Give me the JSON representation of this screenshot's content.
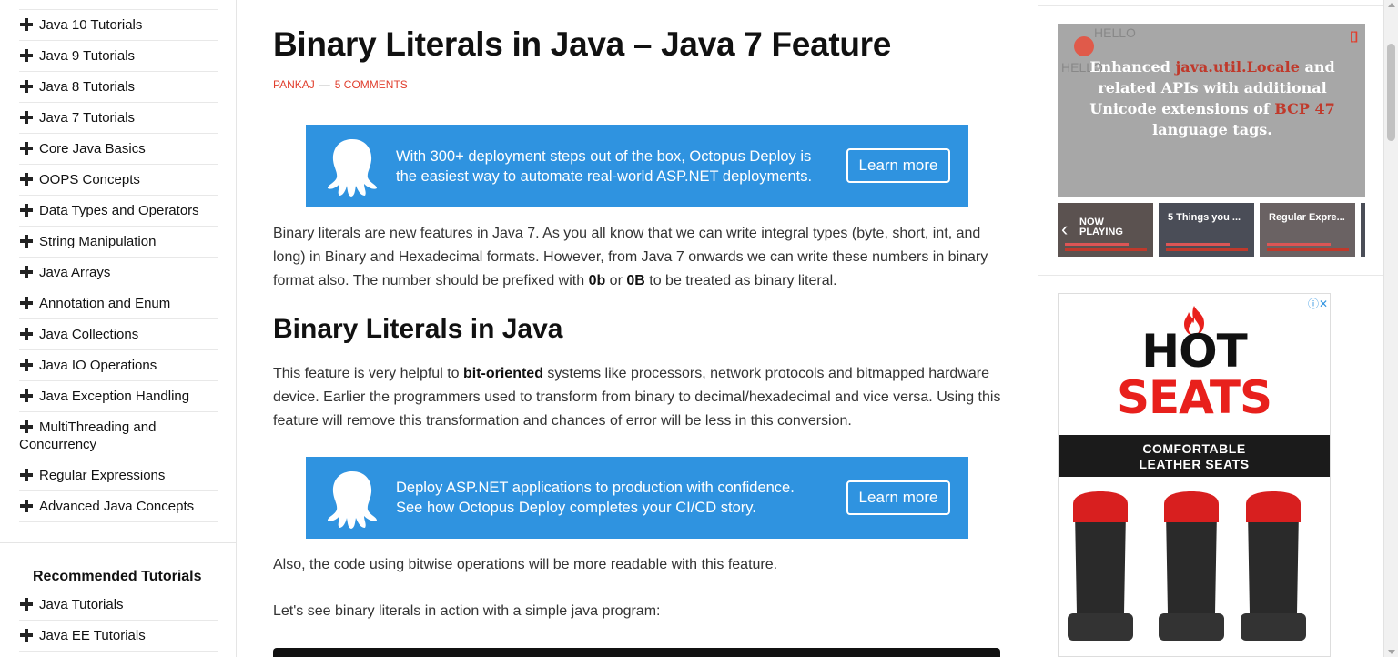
{
  "sidebar": {
    "categories": [
      "Java 10 Tutorials",
      "Java 9 Tutorials",
      "Java 8 Tutorials",
      "Java 7 Tutorials",
      "Core Java Basics",
      "OOPS Concepts",
      "Data Types and Operators",
      "String Manipulation",
      "Java Arrays",
      "Annotation and Enum",
      "Java Collections",
      "Java IO Operations",
      "Java Exception Handling",
      "MultiThreading and",
      "Regular Expressions",
      "Advanced Java Concepts"
    ],
    "multithreading_line2": "Concurrency",
    "recommended_title": "Recommended Tutorials",
    "recommended": [
      "Java Tutorials",
      "Java EE Tutorials"
    ]
  },
  "article": {
    "title": "Binary Literals in Java – Java 7 Feature",
    "author": "PANKAJ",
    "separator": "—",
    "comments": "5 COMMENTS",
    "p1_a": "Binary literals are new features in Java 7. As you all know that we can write integral types (byte, short, int, and long) in Binary and Hexadecimal formats. However, from Java 7 onwards we can write these numbers in binary format also. The number should be prefixed with ",
    "p1_b1": "0b",
    "p1_or": " or ",
    "p1_b2": "0B",
    "p1_end": " to be treated as binary literal.",
    "h2": "Binary Literals in Java",
    "p2_a": "This feature is very helpful to ",
    "p2_b": "bit-oriented",
    "p2_end": " systems like processors, network protocols and bitmapped hardware device. Earlier the programmers used to transform from binary to decimal/hexadecimal and vice versa. Using this feature will remove this transformation and chances of error will be less in this conversion.",
    "p3": "Also, the code using bitwise operations will be more readable with this feature.",
    "p4": "Let's see binary literals in action with a simple java program:"
  },
  "ads": {
    "banner1_text": "With 300+ deployment steps out of the box, Octopus Deploy is the easiest way to automate real-world ASP.NET deployments.",
    "banner1_button": "Learn more",
    "banner2_line1": "Deploy ASP.NET applications to production with confidence.",
    "banner2_line2": "See how Octopus Deploy completes your CI/CD story.",
    "banner2_button": "Learn more",
    "color": "#2f93e0"
  },
  "video": {
    "text_a": "Enhanced ",
    "text_hl1": "java.util.Locale",
    "text_b": " and related APIs with additional Unicode extensions of ",
    "text_hl2": "BCP 47",
    "text_c": " language tags.",
    "bg_hello": "HELLO",
    "bg_hello2": "HELLO",
    "thumbs": [
      {
        "label": "NOW PLAYING"
      },
      {
        "label": "5 Things you ..."
      },
      {
        "label": "Regular Expre..."
      }
    ]
  },
  "side_ad": {
    "hot": "HOT",
    "seats": "SEATS",
    "band_line1": "COMFORTABLE",
    "band_line2": "LEATHER SEATS",
    "accent": "#e8201c"
  }
}
